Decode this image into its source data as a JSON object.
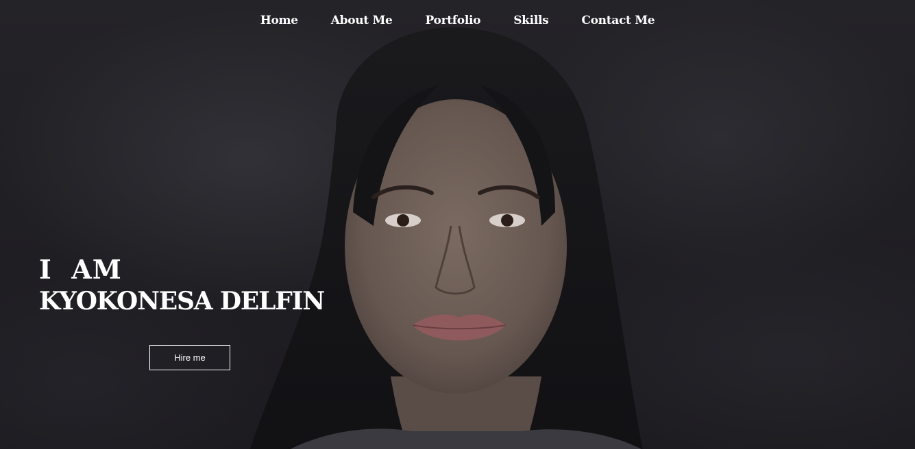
{
  "nav": {
    "items": [
      {
        "label": "Home"
      },
      {
        "label": "About Me"
      },
      {
        "label": "Portfolio"
      },
      {
        "label": "Skills"
      },
      {
        "label": "Contact Me"
      }
    ]
  },
  "hero": {
    "intro": "I  AM",
    "name": "KYOKONESA DELFIN",
    "cta_label": "Hire me"
  },
  "colors": {
    "background": "#1e1d22",
    "text": "#ffffff",
    "button_border": "#ffffff"
  }
}
